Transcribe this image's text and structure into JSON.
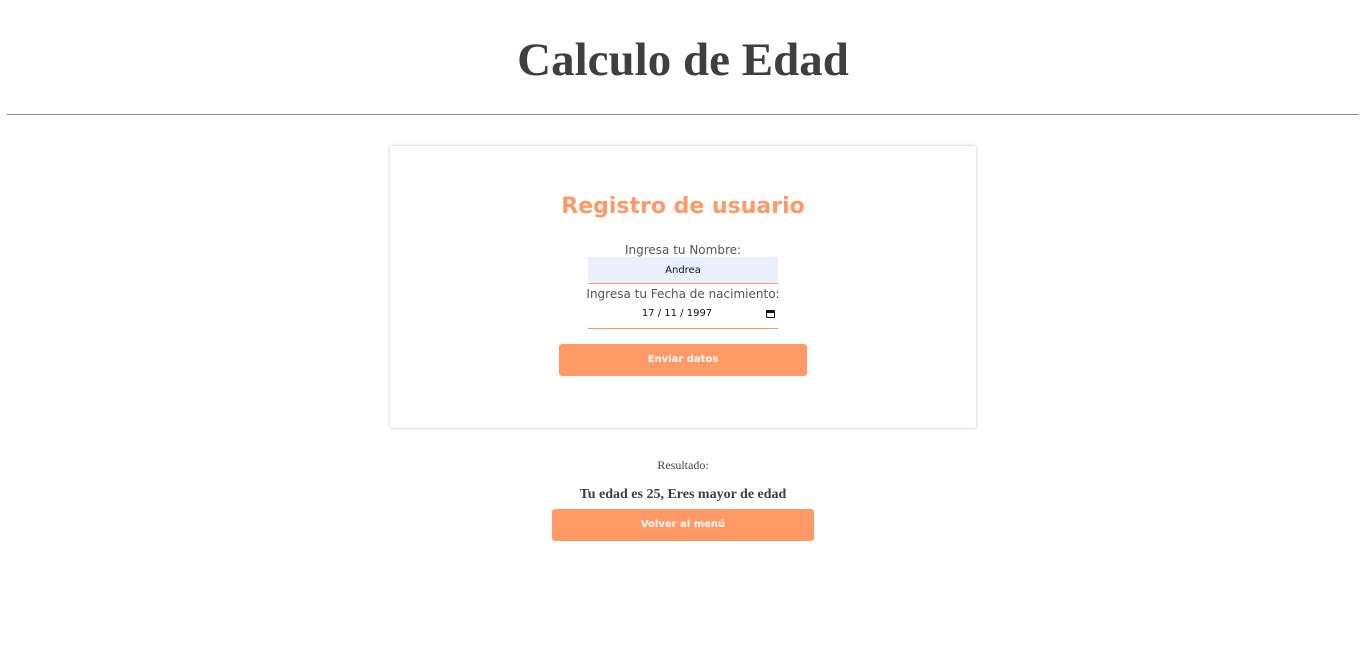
{
  "header": {
    "title": "Calculo de Edad"
  },
  "form": {
    "title": "Registro de usuario",
    "name_label": "Ingresa tu Nombre:",
    "name_value": "Andrea",
    "birthdate_label": "Ingresa tu Fecha de nacimiento:",
    "birthdate_value": "17 / 11 / 1997",
    "submit_label": "Enviar datos"
  },
  "result": {
    "label": "Resultado:",
    "text": "Tu edad es 25, Eres mayor de edad",
    "back_label": "Volver al menú"
  },
  "colors": {
    "accent": "#ff9966",
    "title_text": "#3f3f3f",
    "input_autofill_bg": "#e8f0fe"
  },
  "icons": {
    "date_picker": "calendar-icon"
  }
}
